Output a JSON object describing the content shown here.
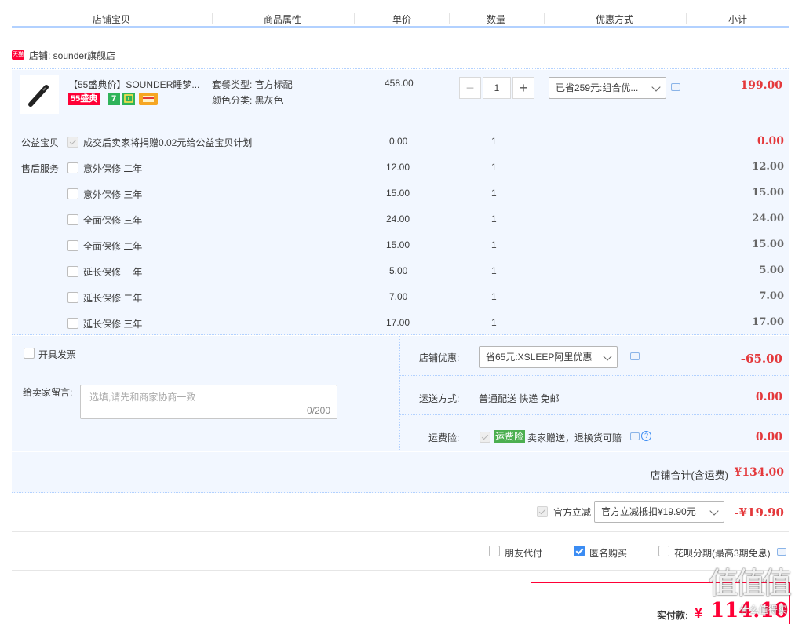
{
  "header": {
    "cols": [
      "店铺宝贝",
      "商品属性",
      "单价",
      "数量",
      "优惠方式",
      "小计"
    ]
  },
  "shop": {
    "badge": "天猫",
    "label": "店铺: sounder旗舰店"
  },
  "item": {
    "title": "【55盛典价】SOUNDER睡梦...",
    "tag_55": "55盛典",
    "tag_7": "7",
    "attr1": "套餐类型: 官方标配",
    "attr2": "颜色分类: 黑灰色",
    "price": "458.00",
    "qty": "1",
    "minus": "−",
    "plus": "+",
    "discount": "已省259元:组合优...",
    "subtotal": "199.00"
  },
  "charity": {
    "label": "公益宝贝",
    "text": "成交后卖家将捐赠0.02元给公益宝贝计划",
    "price": "0.00",
    "qty": "1",
    "subtotal": "0.00"
  },
  "aftersale": {
    "label": "售后服务",
    "rows": [
      {
        "name": "意外保修 二年",
        "price": "12.00",
        "qty": "1",
        "subtotal": "12.00"
      },
      {
        "name": "意外保修 三年",
        "price": "15.00",
        "qty": "1",
        "subtotal": "15.00"
      },
      {
        "name": "全面保修 三年",
        "price": "24.00",
        "qty": "1",
        "subtotal": "24.00"
      },
      {
        "name": "全面保修 二年",
        "price": "15.00",
        "qty": "1",
        "subtotal": "15.00"
      },
      {
        "name": "延长保修 一年",
        "price": "5.00",
        "qty": "1",
        "subtotal": "5.00"
      },
      {
        "name": "延长保修 二年",
        "price": "7.00",
        "qty": "1",
        "subtotal": "7.00"
      },
      {
        "name": "延长保修 三年",
        "price": "17.00",
        "qty": "1",
        "subtotal": "17.00"
      }
    ]
  },
  "invoice": {
    "label": "开具发票"
  },
  "memo": {
    "label": "给卖家留言:",
    "placeholder": "选填,请先和商家协商一致",
    "count": "0/200"
  },
  "store_discount": {
    "label": "店铺优惠:",
    "value": "省65元:XSLEEP阿里优惠",
    "amount": "-65.00"
  },
  "shipping": {
    "label": "运送方式:",
    "value": "普通配送 快递 免邮",
    "amount": "0.00"
  },
  "freight_ins": {
    "label": "运费险:",
    "badge": "运费险",
    "text": "卖家赠送，退换货可赔",
    "amount": "0.00"
  },
  "shop_total": {
    "label": "店铺合计(含运费)",
    "amount": "¥134.00"
  },
  "official": {
    "label": "官方立减",
    "value": "官方立减抵扣¥19.90元",
    "amount": "-¥19.90"
  },
  "options": {
    "friend_pay": "朋友代付",
    "anonymous": "匿名购买",
    "huabei": "花呗分期(最高3期免息)"
  },
  "payment": {
    "label": "实付款:",
    "currency": "¥",
    "amount": "114.10"
  },
  "watermark": {
    "text": "值值值",
    "sub": "什么值得买"
  },
  "colors": {
    "accent_red": "#e4393c",
    "border_blue": "#b2d1ff",
    "row_bg": "#f2f7ff"
  }
}
